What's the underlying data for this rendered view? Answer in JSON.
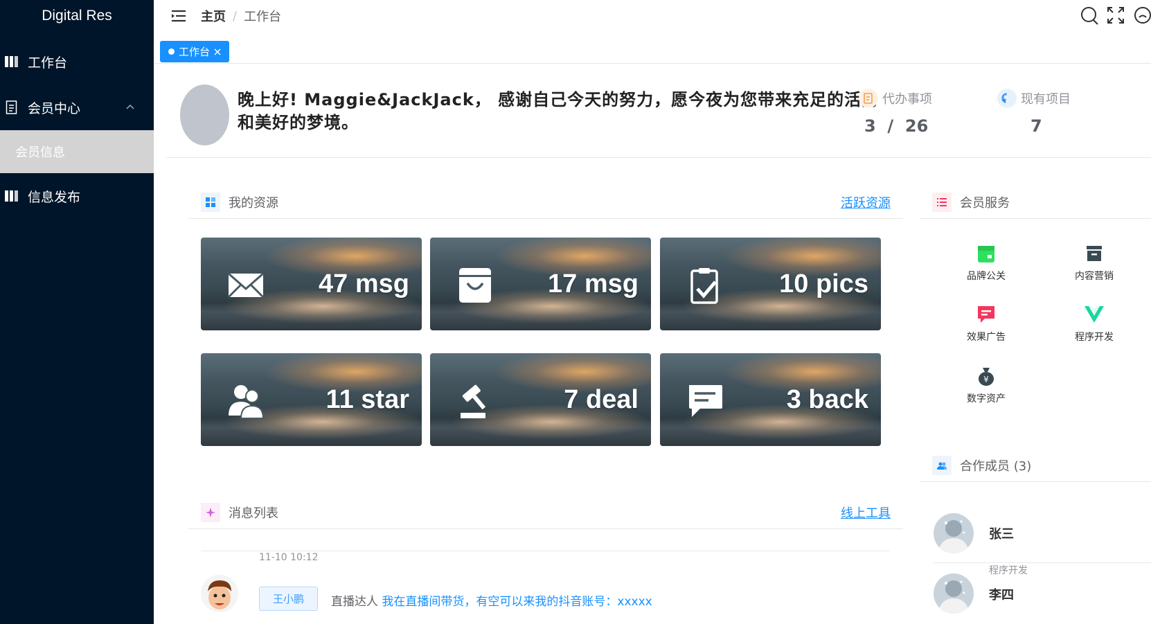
{
  "sidebar": {
    "logo": "Digital Res",
    "items": [
      {
        "label": "工作台"
      },
      {
        "label": "会员中心"
      },
      {
        "label": "会员信息"
      },
      {
        "label": "信息发布"
      }
    ]
  },
  "header": {
    "breadcrumb": [
      "主页",
      "/",
      "工作台"
    ]
  },
  "tags": [
    {
      "label": "工作台"
    }
  ],
  "welcome": {
    "greeting": "晚上好! Maggie&JackJack， 感谢自己今天的努力，愿今夜为您带来充足的活力和美好的梦境。",
    "stats": [
      {
        "label": "代办事项",
        "value": "3  /  26"
      },
      {
        "label": "现有项目",
        "value": "7"
      }
    ]
  },
  "resources": {
    "title": "我的资源",
    "link": "活跃资源",
    "cards": [
      {
        "icon": "mail-icon",
        "text": "47 msg"
      },
      {
        "icon": "shopping-bag-icon",
        "text": "17 msg"
      },
      {
        "icon": "clipboard-check-icon",
        "text": "10 pics"
      },
      {
        "icon": "users-icon",
        "text": "11 star"
      },
      {
        "icon": "gavel-icon",
        "text": "7 deal"
      },
      {
        "icon": "chat-icon",
        "text": "3 back"
      }
    ]
  },
  "messages": {
    "title": "消息列表",
    "link": "线上工具",
    "items": [
      {
        "time": "11-10 10:12",
        "name": "王小鹏",
        "role": "直播达人",
        "text": "我在直播间带货，有空可以来我的抖音账号：xxxxx"
      }
    ]
  },
  "services": {
    "title": "会员服务",
    "items": [
      {
        "label": "品牌公关",
        "icon": "calendar-icon",
        "color": "#2ee05f"
      },
      {
        "label": "内容营销",
        "icon": "archive-icon",
        "color": "#3a4a52"
      },
      {
        "label": "效果广告",
        "icon": "message-icon",
        "color": "#f5365c"
      },
      {
        "label": "程序开发",
        "icon": "vue-icon",
        "color": "#19d6a0"
      },
      {
        "label": "数字资产",
        "icon": "money-bag-icon",
        "color": "#3a4a52"
      }
    ]
  },
  "partners": {
    "title": "合作成员 (3)",
    "members": [
      {
        "name": "张三",
        "role": ""
      },
      {
        "name": "李四",
        "role": "程序开发"
      }
    ]
  }
}
